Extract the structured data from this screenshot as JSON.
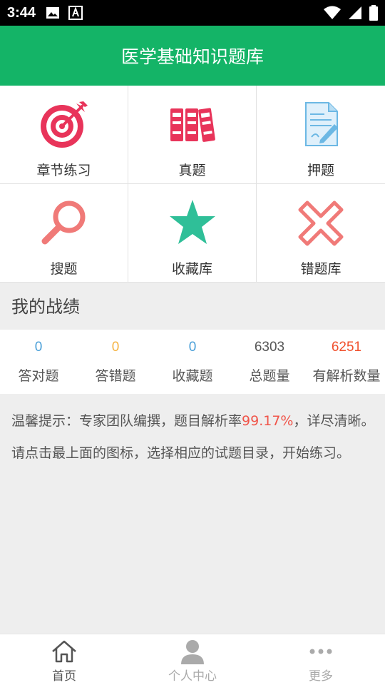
{
  "status_bar": {
    "time": "3:44"
  },
  "header": {
    "title": "医学基础知识题库"
  },
  "grid": [
    {
      "label": "章节练习",
      "icon": "target-icon"
    },
    {
      "label": "真题",
      "icon": "binders-icon"
    },
    {
      "label": "押题",
      "icon": "document-pen-icon"
    },
    {
      "label": "搜题",
      "icon": "magnifier-icon"
    },
    {
      "label": "收藏库",
      "icon": "star-icon"
    },
    {
      "label": "错题库",
      "icon": "cross-icon"
    }
  ],
  "stats_section": {
    "title": "我的战绩"
  },
  "stats": [
    {
      "value": "0",
      "label": "答对题",
      "color": "#4a9fd8"
    },
    {
      "value": "0",
      "label": "答错题",
      "color": "#f5b342"
    },
    {
      "value": "0",
      "label": "收藏题",
      "color": "#4a9fd8"
    },
    {
      "value": "6303",
      "label": "总题量",
      "color": "#555555"
    },
    {
      "value": "6251",
      "label": "有解析数量",
      "color": "#f0502d"
    }
  ],
  "tips": {
    "part1": "温馨提示：专家团队编撰，题目解析率",
    "rate": "99.17%",
    "part2": "，详尽清晰。",
    "line2": "请点击最上面的图标，选择相应的试题目录，开始练习。"
  },
  "tabbar": [
    {
      "label": "首页",
      "icon": "home-icon",
      "active": true
    },
    {
      "label": "个人中心",
      "icon": "user-icon",
      "active": false
    },
    {
      "label": "更多",
      "icon": "more-dots-icon",
      "active": false
    }
  ],
  "colors": {
    "primary": "#14b467",
    "accent_red": "#e8345a",
    "accent_teal": "#2fbf98"
  }
}
